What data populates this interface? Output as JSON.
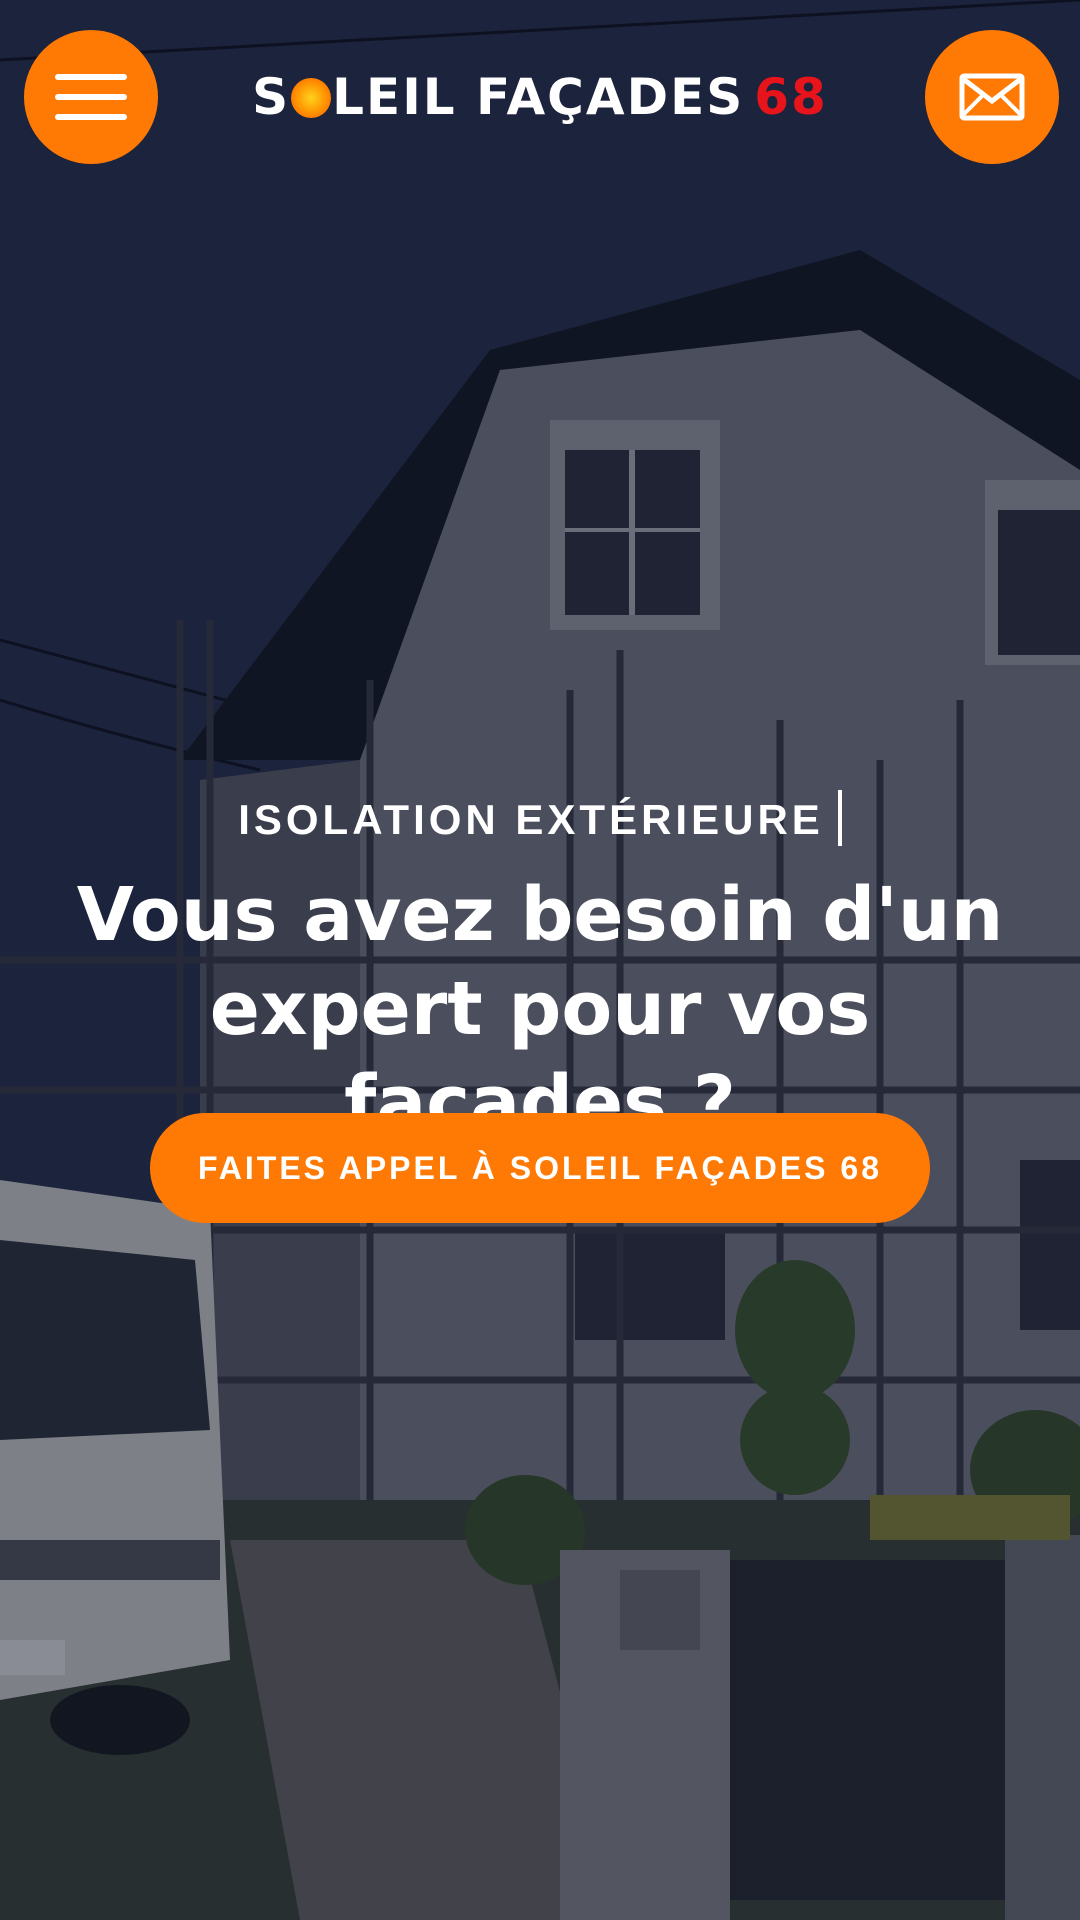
{
  "header": {
    "menu_icon": "hamburger-menu-icon",
    "logo": {
      "part1": "S",
      "part2": "LEIL FAÇADES",
      "number": "68"
    },
    "contact_icon": "envelope-icon"
  },
  "hero": {
    "eyebrow": "ISOLATION EXTÉRIEURE",
    "headline_line1": "Vous avez besoin d'un",
    "headline_line2": "expert pour vos façades ?",
    "cta_label": "FAITES APPEL À SOLEIL FAÇADES 68"
  },
  "colors": {
    "accent": "#ff7a05",
    "logo_number": "#e8141c",
    "text": "#ffffff"
  }
}
